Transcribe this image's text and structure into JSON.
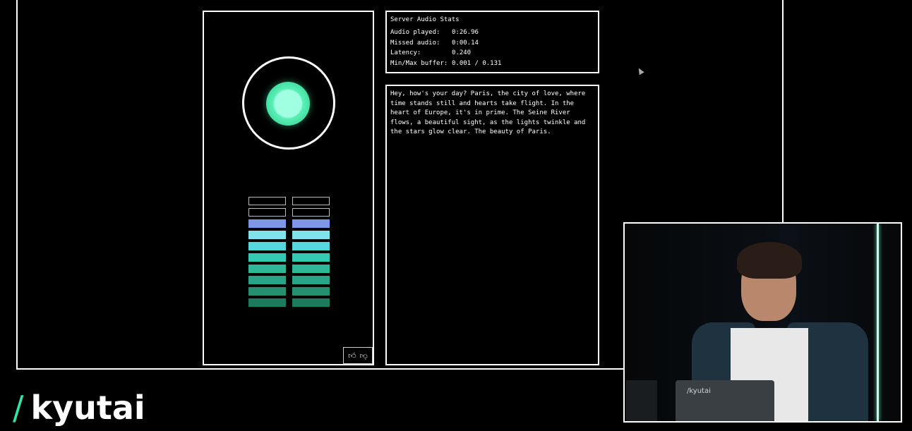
{
  "stats": {
    "title": "Server Audio Stats",
    "rows": [
      {
        "label": "Audio played:",
        "value": "0:26.96"
      },
      {
        "label": "Missed audio:",
        "value": "0:00.14"
      },
      {
        "label": "Latency:",
        "value": "0.240"
      },
      {
        "label": "Min/Max buffer:",
        "value": "0.001 / 0.131"
      }
    ]
  },
  "transcript": {
    "text": "Hey, how's your day? Paris, the city of love, where time stands still and hearts take flight. In the heart of Europe, it's in prime. The Seine River flows, a beautiful sight, as the lights twinkle and the stars glow clear. The beauty of Paris."
  },
  "meter": {
    "rows": [
      {
        "left": "empty",
        "right": "empty"
      },
      {
        "left": "empty",
        "right": "empty"
      },
      {
        "left": "#7f95e8",
        "right": "#7f95e8"
      },
      {
        "left": "#7fe3ea",
        "right": "#7fe3ea"
      },
      {
        "left": "#56d7dc",
        "right": "#56d7dc"
      },
      {
        "left": "#33c9b3",
        "right": "#33c9b3"
      },
      {
        "left": "#2fb898",
        "right": "#2fb898"
      },
      {
        "left": "#2aa486",
        "right": "#2aa486"
      },
      {
        "left": "#24906f",
        "right": "#24906f"
      },
      {
        "left": "#1e7a5d",
        "right": "#1e7a5d"
      }
    ]
  },
  "colors": {
    "accent": "#35e1a7",
    "orb_core": "#9fffe0"
  },
  "feedback": {
    "thumbs_up_icon": "thumbs-up-icon",
    "thumbs_down_icon": "thumbs-down-icon"
  },
  "brand": {
    "slash": "/",
    "name": "kyutai"
  },
  "video": {
    "laptop_label": "/kyutai"
  }
}
